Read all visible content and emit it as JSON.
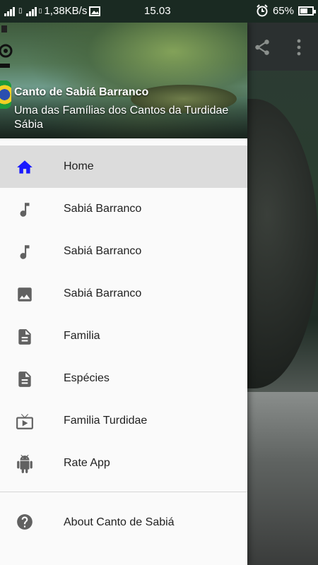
{
  "status_bar": {
    "network_speed": "1,38KB/s",
    "time": "15.03",
    "battery": "65%",
    "battery_level": 0.65
  },
  "drawer": {
    "header": {
      "title": "Canto de Sabiá Barranco",
      "subtitle": "Uma das Famílias dos Cantos da Turdidae Sábia"
    },
    "items": [
      {
        "label": "Home",
        "icon": "home-icon",
        "active": true
      },
      {
        "label": "Sabiá Barranco",
        "icon": "music-note-icon"
      },
      {
        "label": "Sabiá Barranco",
        "icon": "music-note-icon"
      },
      {
        "label": "Sabiá Barranco",
        "icon": "image-icon"
      },
      {
        "label": "Familia",
        "icon": "document-icon"
      },
      {
        "label": "Espécies",
        "icon": "document-icon"
      },
      {
        "label": "Familia Turdidae",
        "icon": "tv-play-icon"
      },
      {
        "label": "Rate App",
        "icon": "android-icon"
      }
    ],
    "footer": {
      "label": "About Canto de Sabiá",
      "icon": "help-circle-icon"
    }
  },
  "colors": {
    "active_icon": "#1a1aff",
    "icon_gray": "#616161",
    "active_bg": "#dcdcdc"
  }
}
